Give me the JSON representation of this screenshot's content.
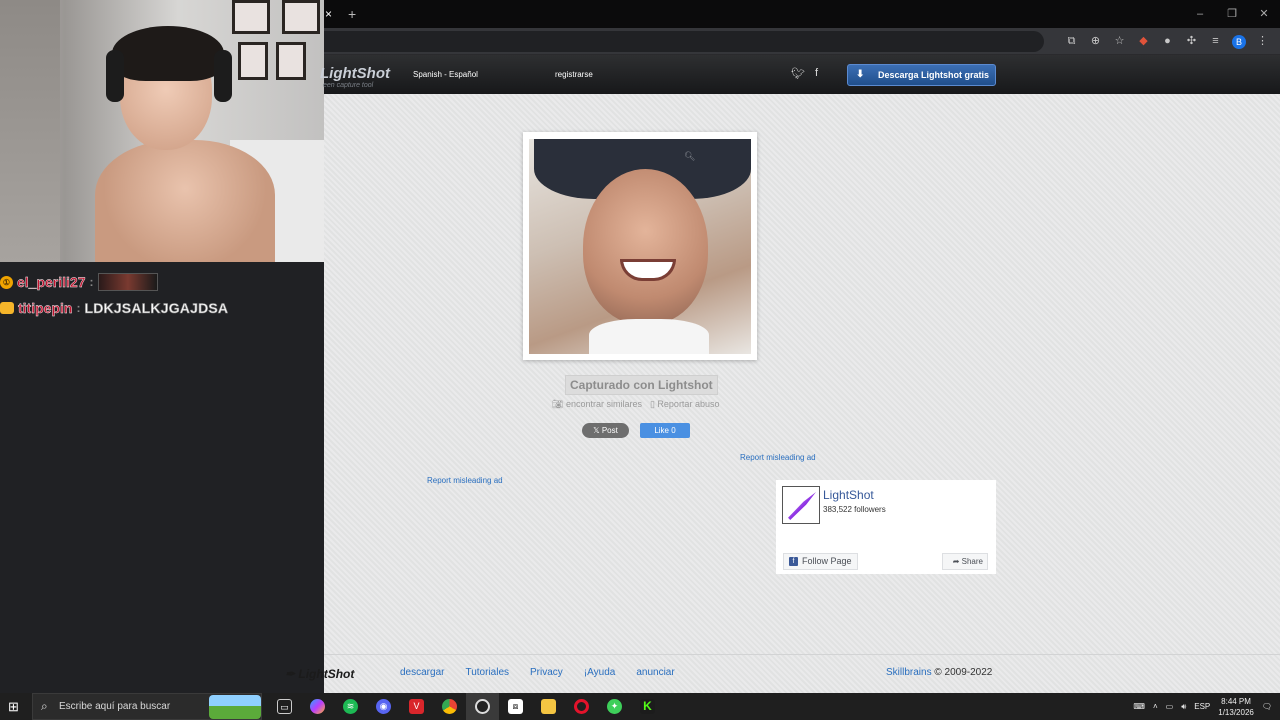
{
  "browser": {
    "tab_close": "×",
    "new_tab": "+",
    "window_controls": [
      "–",
      "❐",
      "✕"
    ],
    "profile_initial": "B"
  },
  "lightshot": {
    "logo": "LightShot",
    "logo_sub": "een capture tool",
    "language": "Spanish - Español",
    "register": "registrarse",
    "download_button": "Descarga Lightshot gratis",
    "captured_label": "Capturado con Lightshot",
    "find_similar": "encontrar similares",
    "report_abuse": "Reportar abuso",
    "post_button": "𝕏 Post",
    "like_button": "Like 0",
    "report_ad_1": "Report misleading ad",
    "report_ad_2": "Report misleading ad"
  },
  "facebook_widget": {
    "page_name": "LightShot",
    "followers": "383,522 followers",
    "follow_button": "Follow Page",
    "share_button": "Share"
  },
  "footer": {
    "logo": "LightShot",
    "links": [
      "descargar",
      "Tutoriales",
      "Privacy",
      "¡Ayuda",
      "anunciar"
    ],
    "brand": "Skillbrains",
    "copyright": "© 2009-2022"
  },
  "chat": {
    "messages": [
      {
        "user": "el_perili27",
        "sep": ":",
        "message": ""
      },
      {
        "user": "titipepin",
        "sep": ":",
        "message": "LDKJSALKJGAJDSA"
      }
    ]
  },
  "taskbar": {
    "search_placeholder": "Escribe aquí para buscar",
    "language": "ESP",
    "time": "8:44 PM",
    "date": "1/13/2026"
  }
}
